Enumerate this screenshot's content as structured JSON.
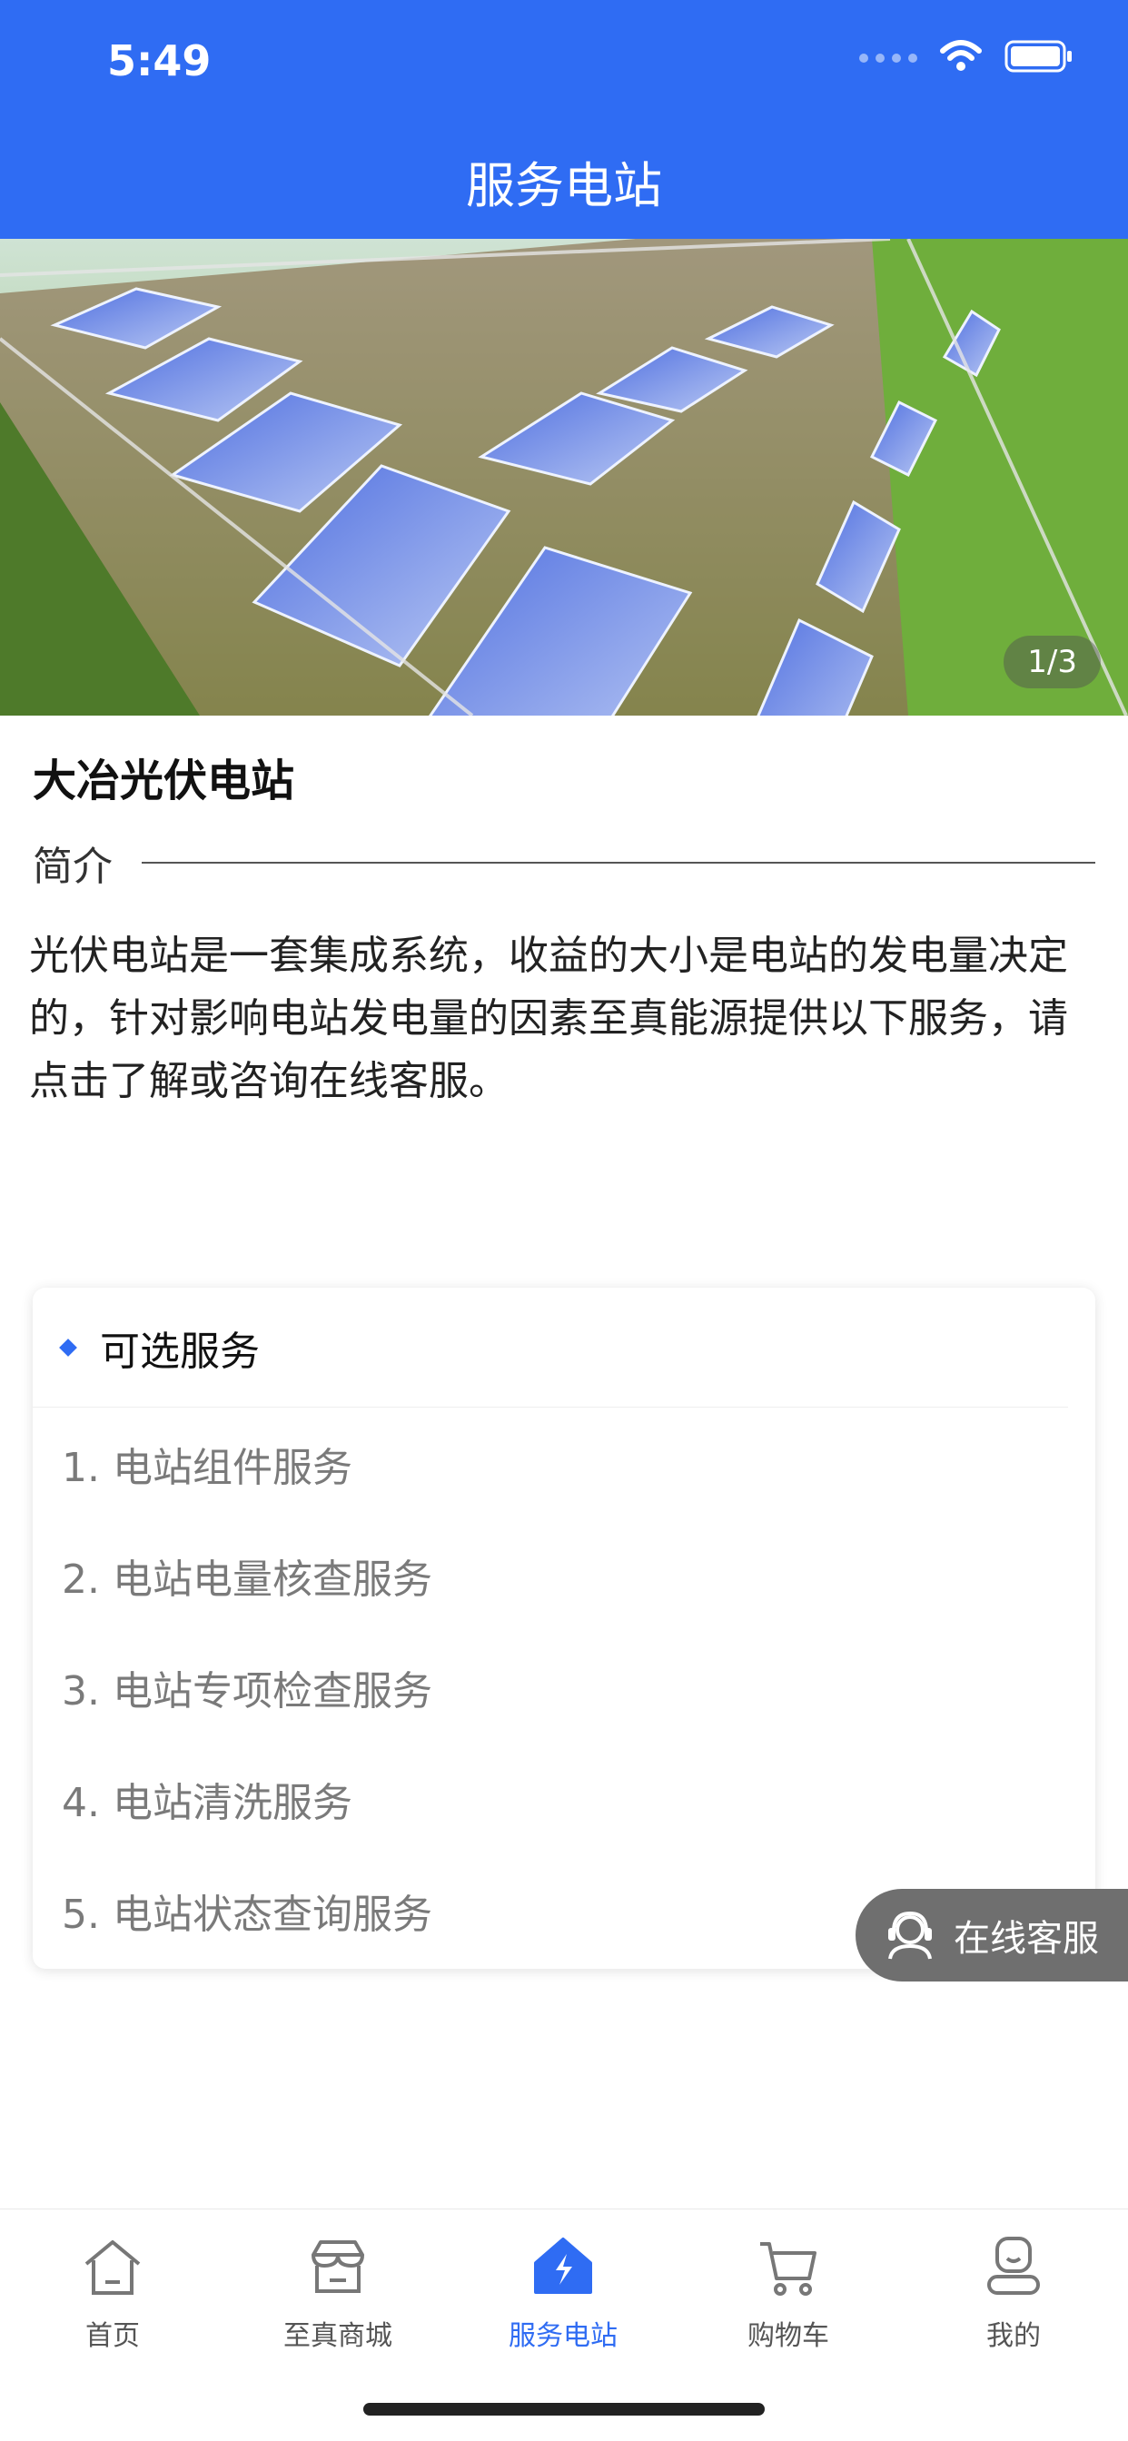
{
  "status_bar": {
    "time": "5:49"
  },
  "nav": {
    "title": "服务电站"
  },
  "banner": {
    "counter": "1/3"
  },
  "station": {
    "name": "大冶光伏电站",
    "intro_label": "简介",
    "intro_text": "光伏电站是一套集成系统，收益的大小是电站的发电量决定的，针对影响电站发电量的因素至真能源提供以下服务，请点击了解或咨询在线客服。"
  },
  "services": {
    "title": "可选服务",
    "items": [
      "1. 电站组件服务",
      "2. 电站电量核查服务",
      "3. 电站专项检查服务",
      "4. 电站清洗服务",
      "5. 电站状态查询服务"
    ]
  },
  "online_service": {
    "label": "在线客服"
  },
  "tabbar": {
    "items": [
      {
        "label": "首页",
        "icon": "home-icon"
      },
      {
        "label": "至真商城",
        "icon": "store-icon"
      },
      {
        "label": "服务电站",
        "icon": "power-station-icon"
      },
      {
        "label": "购物车",
        "icon": "cart-icon"
      },
      {
        "label": "我的",
        "icon": "profile-icon"
      }
    ],
    "active_index": 2
  },
  "colors": {
    "accent": "#2f6cf3",
    "muted_text": "#7a7a7a"
  }
}
